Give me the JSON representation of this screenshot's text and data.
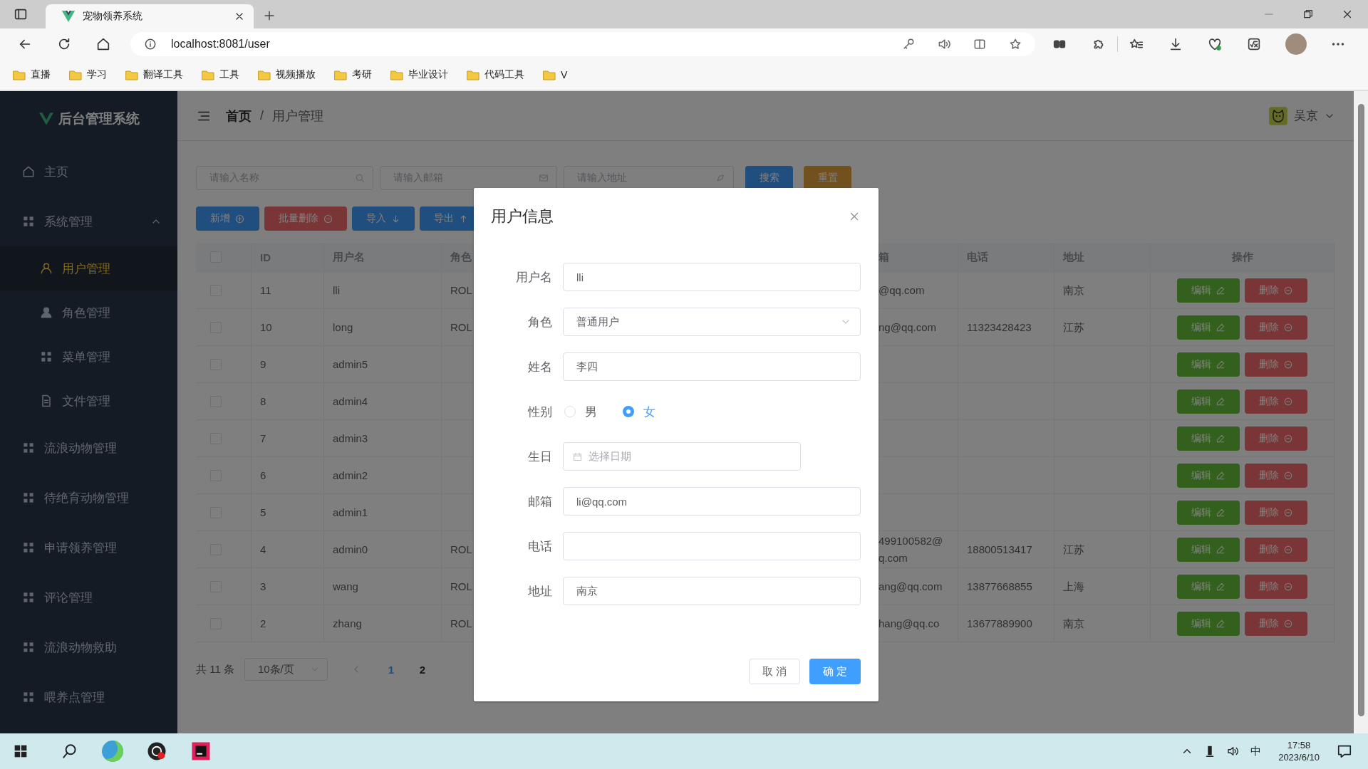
{
  "browser": {
    "tab_title": "宠物领养系统",
    "url": "localhost:8081/user",
    "bookmarks": [
      "直播",
      "学习",
      "翻译工具",
      "工具",
      "视频播放",
      "考研",
      "毕业设计",
      "代码工具",
      "V"
    ]
  },
  "app": {
    "brand": "后台管理系统",
    "sidebar": [
      {
        "label": "主页",
        "selected": false
      },
      {
        "label": "系统管理",
        "selected": false,
        "expanded": true,
        "children": [
          {
            "label": "用户管理",
            "selected": true
          },
          {
            "label": "角色管理",
            "selected": false
          },
          {
            "label": "菜单管理",
            "selected": false
          },
          {
            "label": "文件管理",
            "selected": false
          }
        ]
      },
      {
        "label": "流浪动物管理",
        "selected": false
      },
      {
        "label": "待绝育动物管理",
        "selected": false
      },
      {
        "label": "申请领养管理",
        "selected": false
      },
      {
        "label": "评论管理",
        "selected": false
      },
      {
        "label": "流浪动物救助",
        "selected": false
      },
      {
        "label": "喂养点管理",
        "selected": false
      }
    ],
    "breadcrumb": [
      "首页",
      "用户管理"
    ],
    "breadcrumb_separator": "/",
    "user_name": "吴京",
    "search": {
      "placeholders": [
        "请输入名称",
        "请输入邮箱",
        "请输入地址"
      ],
      "buttons": [
        "搜索",
        "重置"
      ]
    },
    "toolbar": [
      "新增",
      "批量删除",
      "导入",
      "导出"
    ],
    "table": {
      "select_all_checked": false,
      "columns": [
        "ID",
        "用户名",
        "角色",
        "箱",
        "电话",
        "地址",
        "操作"
      ],
      "rows": [
        {
          "checked": false,
          "id": "11",
          "username": "lli",
          "role": "ROL",
          "email": "@qq.com",
          "phone": "",
          "address": "南京",
          "actions": [
            "编辑",
            "删除"
          ]
        },
        {
          "checked": false,
          "id": "10",
          "username": "long",
          "role": "ROL",
          "email": "ng@qq.com",
          "phone": "11323428423",
          "address": "江苏",
          "actions": [
            "编辑",
            "删除"
          ]
        },
        {
          "checked": false,
          "id": "9",
          "username": "admin5",
          "actions": [
            "编辑",
            "删除"
          ]
        },
        {
          "checked": false,
          "id": "8",
          "username": "admin4",
          "actions": [
            "编辑",
            "删除"
          ]
        },
        {
          "checked": false,
          "id": "7",
          "username": "admin3",
          "actions": [
            "编辑",
            "删除"
          ]
        },
        {
          "checked": false,
          "id": "6",
          "username": "admin2",
          "actions": [
            "编辑",
            "删除"
          ]
        },
        {
          "checked": false,
          "id": "5",
          "username": "admin1",
          "actions": [
            "编辑",
            "删除"
          ]
        },
        {
          "checked": false,
          "id": "4",
          "username": "admin0",
          "role": "ROL",
          "email": "499100582@\nq.com",
          "phone": "18800513417",
          "address": "江苏",
          "actions": [
            "编辑",
            "删除"
          ]
        },
        {
          "checked": false,
          "id": "3",
          "username": "wang",
          "role": "ROL",
          "email": "ang@qq.com",
          "phone": "13877668855",
          "address": "上海",
          "actions": [
            "编辑",
            "删除"
          ]
        },
        {
          "checked": false,
          "id": "2",
          "username": "zhang",
          "role": "ROL",
          "email": "hang@qq.co",
          "phone": "13677889900",
          "address": "南京",
          "actions": [
            "编辑",
            "删除"
          ]
        }
      ]
    },
    "pagination": {
      "total": "共 11 条",
      "page_size": "10条/页",
      "pages": [
        {
          "label": "1",
          "selected": true
        },
        {
          "label": "2",
          "selected": false
        }
      ]
    }
  },
  "dialog": {
    "title": "用户信息",
    "fields": [
      {
        "kind": "text",
        "label": "用户名",
        "value": "lli"
      },
      {
        "kind": "select",
        "label": "角色",
        "value": "普通用户"
      },
      {
        "kind": "text",
        "label": "姓名",
        "value": "李四"
      },
      {
        "kind": "radio",
        "label": "性别",
        "options": [
          {
            "label": "男",
            "selected": false
          },
          {
            "label": "女",
            "selected": true
          }
        ]
      },
      {
        "kind": "date",
        "label": "生日",
        "placeholder": "选择日期"
      },
      {
        "kind": "text",
        "label": "邮箱",
        "value": "li@qq.com"
      },
      {
        "kind": "text",
        "label": "电话"
      },
      {
        "kind": "text",
        "label": "地址",
        "value": "南京"
      }
    ],
    "buttons": [
      "取 消",
      "确 定"
    ]
  },
  "taskbar": {
    "ime": "中",
    "time": "17:58",
    "date": "2023/6/10"
  }
}
